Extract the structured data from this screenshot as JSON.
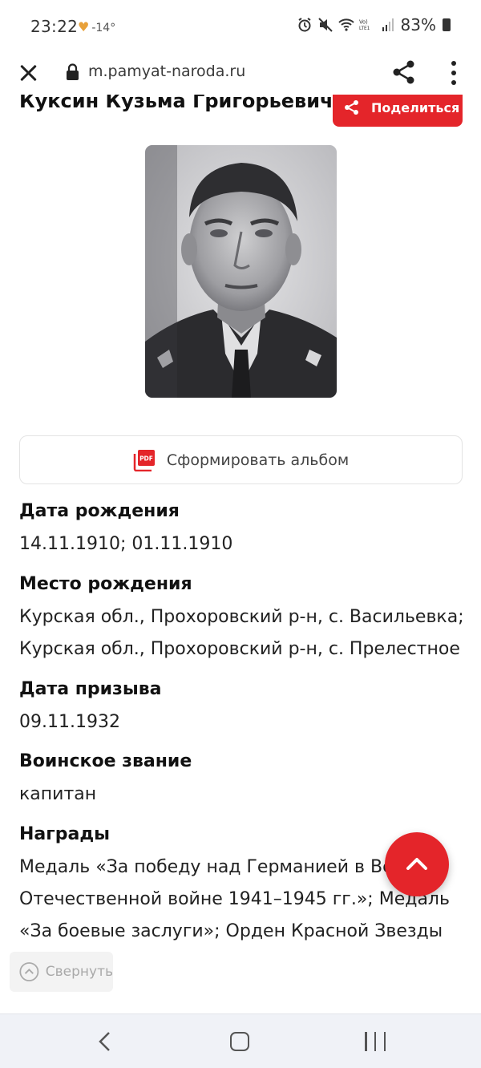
{
  "status_bar": {
    "time": "23:22",
    "temperature": "-14°",
    "battery": "83%"
  },
  "browser": {
    "url": "m.pamyat-naroda.ru"
  },
  "page": {
    "title": "Куксин Кузьма Григорьевич",
    "share_label": "Поделиться",
    "album_label": "Сформировать альбом",
    "pdf_icon_text": "PDF",
    "fields": [
      {
        "label": "Дата рождения",
        "value": "14.11.1910; 01.11.1910"
      },
      {
        "label": "Место рождения",
        "value_lines": [
          "Курская обл., Прохоровский р-н, с. Васильевка;",
          "Курская обл., Прохоровский р-н, с. Прелестное"
        ]
      },
      {
        "label": "Дата призыва",
        "value": "09.11.1932"
      },
      {
        "label": "Воинское звание",
        "value": "капитан"
      },
      {
        "label": "Награды",
        "value_lines": [
          "Медаль «За победу над Германией в Великой",
          "Отечественной войне 1941–1945 гг.»; Медаль",
          "«За боевые заслуги»; Орден Красной Звезды"
        ]
      }
    ],
    "collapse_label": "Свернуть"
  },
  "colors": {
    "accent": "#e4252a",
    "nav_bg": "#f0f2f7"
  }
}
